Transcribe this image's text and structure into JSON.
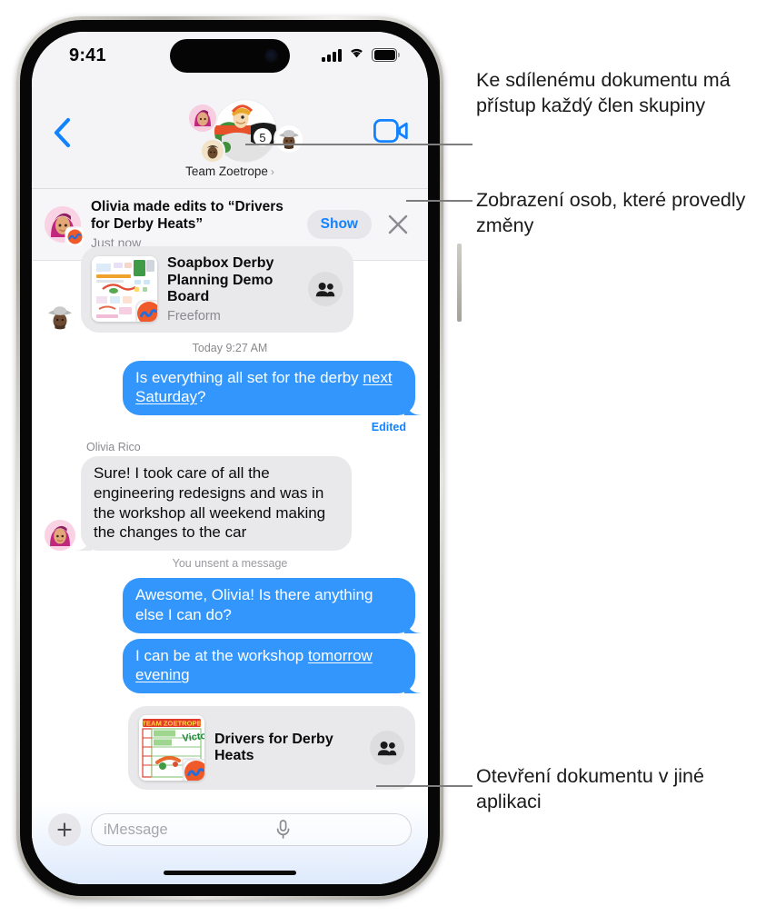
{
  "status_bar": {
    "time": "9:41",
    "cellular_icon": "cellular-signal-icon",
    "wifi_icon": "wifi-icon",
    "battery_icon": "battery-icon"
  },
  "nav_bar": {
    "back_icon": "chevron-left-icon",
    "facetime_icon": "facetime-video-icon",
    "group_name": "Team Zoetrope",
    "group_chevron": "›",
    "group_avatar_main": "soapbox-car-number-5-avatar",
    "group_avatar_member_1": "memoji-olivia-avatar",
    "group_avatar_member_2": "memoji-man-hat-avatar",
    "group_avatar_member_3": "memoji-small-avatar"
  },
  "collab_banner": {
    "avatar": "olivia-avatar",
    "app_badge": "freeform-app-badge-icon",
    "title": "Olivia made edits to “Drivers for Derby Heats”",
    "subtitle": "Just now",
    "show_label": "Show",
    "close_icon": "close-x-icon"
  },
  "thread": {
    "doc_card_top": {
      "avatar": "memoji-man-hat-avatar",
      "thumbnail": "freeform-board-thumbnail",
      "app_badge": "freeform-app-badge-icon",
      "name": "Soapbox Derby Planning Demo Board",
      "app": "Freeform",
      "people_icon": "two-people-icon"
    },
    "timestamp": "Today 9:27 AM",
    "message_1": {
      "text_before": "Is everything all set for the derby ",
      "link_text": "next Saturday",
      "text_after": "?",
      "edited_label": "Edited"
    },
    "sender_name": "Olivia Rico",
    "message_2": {
      "avatar": "memoji-olivia-avatar",
      "text": "Sure! I took care of all the engineering redesigns and was in the workshop all weekend making the changes to the car"
    },
    "unsent_note": "You unsent a message",
    "message_3": {
      "text": "Awesome, Olivia! Is there anything else I can do?"
    },
    "message_4": {
      "text_before": "I can be at the workshop ",
      "link_text": "tomorrow evening",
      "text_after": ""
    },
    "doc_card_bottom": {
      "thumbnail": "drivers-for-derby-heats-thumbnail",
      "app_badge": "freeform-app-badge-icon",
      "name": "Drivers for Derby Heats",
      "people_icon": "two-people-icon"
    }
  },
  "composer": {
    "plus_icon": "plus-icon",
    "placeholder": "iMessage",
    "value": "",
    "mic_icon": "microphone-icon"
  },
  "annotations": {
    "callout_1": "Ke sdílenému dokumentu má přístup každý člen skupiny",
    "callout_2": "Zobrazení osob, které provedly změny",
    "callout_3": "Otevření dokumentu v jiné aplikaci"
  },
  "colors": {
    "imessage_blue": "#3396fd",
    "accent_blue": "#1282ff",
    "bubble_gray": "#e9e9eb",
    "chrome_gray": "#f4f4f6",
    "secondary_text": "#8a8a8f",
    "leader_line": "#7d7d7d"
  }
}
